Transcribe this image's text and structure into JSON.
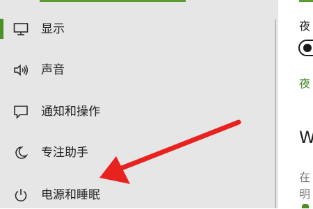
{
  "sidebar": {
    "items": [
      {
        "label": "显示",
        "icon": "monitor-icon"
      },
      {
        "label": "声音",
        "icon": "speaker-icon"
      },
      {
        "label": "通知和操作",
        "icon": "notification-icon"
      },
      {
        "label": "专注助手",
        "icon": "moon-icon"
      },
      {
        "label": "电源和睡眠",
        "icon": "power-icon"
      }
    ]
  },
  "right_panel": {
    "night_light_label": "夜",
    "night_light_link": "夜",
    "section_heading": "W",
    "desc_line1": "在",
    "desc_line2": "明"
  },
  "annotation": {
    "arrow": "red-arrow-icon",
    "color": "#e8231f"
  },
  "colors": {
    "accent": "#4c8f25",
    "sidebar_bg": "#e6e6e6",
    "link_green": "#3b8a1a"
  }
}
